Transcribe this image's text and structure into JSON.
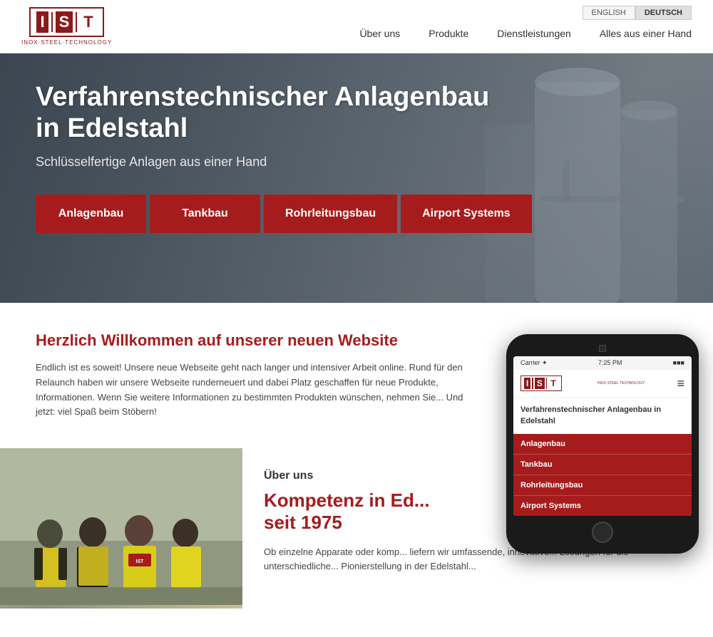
{
  "lang": {
    "english": "ENGLISH",
    "deutsch": "DEUTSCH"
  },
  "logo": {
    "letters": [
      "I",
      "S",
      "T"
    ],
    "subtitle": "INOX·STEEL·TECHNOLOGY"
  },
  "nav": {
    "items": [
      {
        "label": "Über uns",
        "href": "#"
      },
      {
        "label": "Produkte",
        "href": "#"
      },
      {
        "label": "Dienstleistungen",
        "href": "#"
      },
      {
        "label": "Alles aus einer Hand",
        "href": "#"
      }
    ]
  },
  "hero": {
    "title": "Verfahrenstechnischer Anlagenbau\nin Edelstahl",
    "subtitle": "Schlüsselfertige Anlagen aus einer Hand",
    "buttons": [
      {
        "label": "Anlagenbau"
      },
      {
        "label": "Tankbau"
      },
      {
        "label": "Rohrleitungsbau"
      },
      {
        "label": "Airport Systems"
      }
    ]
  },
  "welcome": {
    "title": "Herzlich Willkommen auf unserer neuen Website",
    "text": "Endlich ist es soweit! Unsere neue Webseite geht nach langer und intensiver Arbeit online. Rund für den Relaunch haben wir unsere Webseite runderneuert und dabei Platz geschaffen für neue Produkte, Informationen. Wenn Sie weitere Informationen zu bestimmten Produkten wünschen, nehmen Sie... Und jetzt: viel Spaß beim Stöbern!"
  },
  "about": {
    "label": "Über uns",
    "title": "Kompetenz in Ed...\nseit 1975",
    "text": "Ob einzelne Apparate oder komp... liefern wir umfassende, innovative... Lösungen für die unterschiedliche... Pionierstellung in der Edelstahl..."
  },
  "phone": {
    "carrier": "Carrier ✦",
    "time": "7:25 PM",
    "battery": "■■■",
    "hero_text": "Verfahrenstechnischer\nAnlagenbau in Edelstahl",
    "buttons": [
      {
        "label": "Anlagenbau"
      },
      {
        "label": "Tankbau"
      },
      {
        "label": "Rohrleitungsbau"
      },
      {
        "label": "Airport Systems"
      }
    ]
  }
}
